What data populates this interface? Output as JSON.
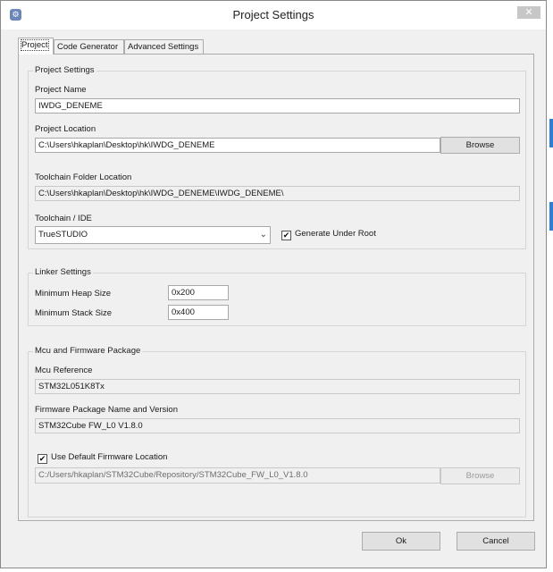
{
  "window": {
    "title": "Project Settings",
    "close_glyph": "✕",
    "app_icon": "gear-icon",
    "app_icon_glyph": "⚙"
  },
  "tabs": [
    {
      "label": "Project",
      "active": true
    },
    {
      "label": "Code Generator",
      "active": false
    },
    {
      "label": "Advanced Settings",
      "active": false
    }
  ],
  "project_settings": {
    "group_title": "Project Settings",
    "name_label": "Project Name",
    "name_value": "IWDG_DENEME",
    "location_label": "Project Location",
    "location_value": "C:\\Users\\hkaplan\\Desktop\\hk\\IWDG_DENEME",
    "browse_label": "Browse",
    "toolchain_folder_label": "Toolchain Folder Location",
    "toolchain_folder_value": "C:\\Users\\hkaplan\\Desktop\\hk\\IWDG_DENEME\\IWDG_DENEME\\",
    "toolchain_ide_label": "Toolchain / IDE",
    "toolchain_ide_value": "TrueSTUDIO",
    "generate_under_root_label": "Generate Under Root",
    "generate_under_root_checked": true
  },
  "linker_settings": {
    "group_title": "Linker Settings",
    "heap_label": "Minimum Heap Size",
    "heap_value": "0x200",
    "stack_label": "Minimum Stack Size",
    "stack_value": "0x400"
  },
  "mcu_firmware": {
    "group_title": "Mcu and Firmware Package",
    "mcu_label": "Mcu Reference",
    "mcu_value": "STM32L051K8Tx",
    "fw_label": "Firmware Package Name and Version",
    "fw_value": "STM32Cube FW_L0 V1.8.0",
    "use_default_label": "Use Default Firmware Location",
    "use_default_checked": true,
    "fw_location_value": "C:/Users/hkaplan/STM32Cube/Repository/STM32Cube_FW_L0_V1.8.0",
    "browse_label": "Browse"
  },
  "footer": {
    "ok_label": "Ok",
    "cancel_label": "Cancel"
  },
  "check_glyph": "✔",
  "dropdown_glyph": "⌄",
  "colors": {
    "accent": "#2b7fd6",
    "window_bg": "#f0f0f0",
    "close_button": "#c7c7c7"
  }
}
